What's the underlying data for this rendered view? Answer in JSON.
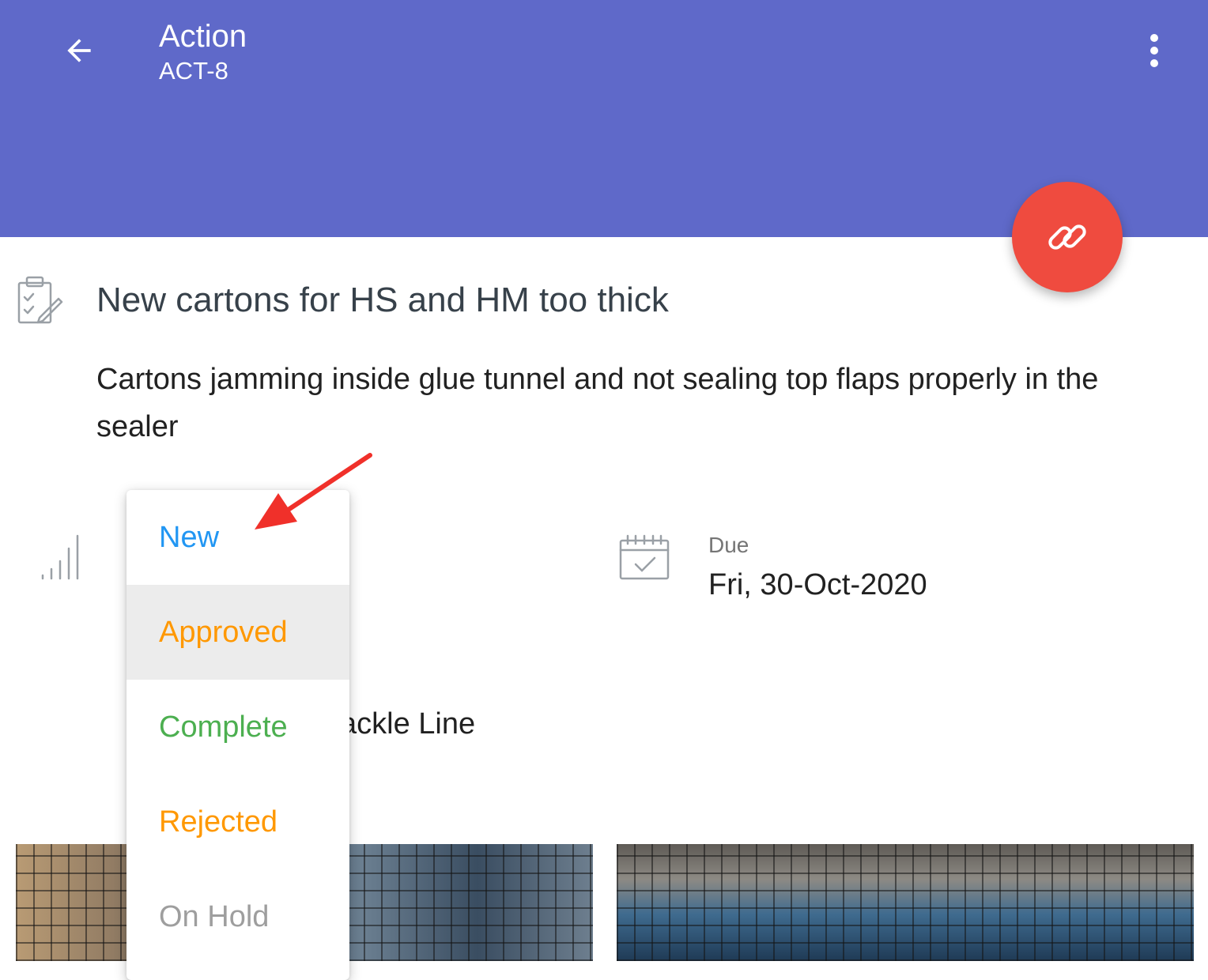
{
  "appbar": {
    "title": "Action",
    "subtitle": "ACT-8",
    "color": "#5f69c9",
    "back_icon": "arrow-left-icon",
    "more_icon": "more-vert-icon"
  },
  "fab": {
    "icon": "link-icon",
    "color": "#ef4b3f"
  },
  "action": {
    "title": "New cartons for HS and HM too thick",
    "description": "Cartons jamming inside glue tunnel and not sealing top flaps properly in the sealer",
    "due_label": "Due",
    "due_value": "Fri, 30-Oct-2020",
    "location_partial": "ackle Line"
  },
  "status_menu": {
    "items": [
      {
        "label": "New",
        "color": "#2196f3"
      },
      {
        "label": "Approved",
        "color": "#ff9800",
        "highlighted": true
      },
      {
        "label": "Complete",
        "color": "#4caf50"
      },
      {
        "label": "Rejected",
        "color": "#ff9800"
      },
      {
        "label": "On Hold",
        "color": "#9e9e9e"
      }
    ]
  },
  "annotation": {
    "arrow_color": "#f0302a"
  }
}
